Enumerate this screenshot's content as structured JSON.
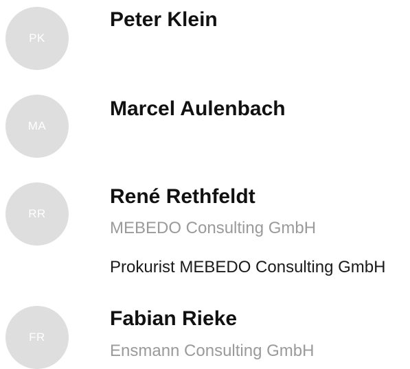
{
  "contacts": [
    {
      "initials": "PK",
      "name": "Peter Klein"
    },
    {
      "initials": "MA",
      "name": "Marcel Aulenbach"
    },
    {
      "initials": "RR",
      "name": "René Rethfeldt",
      "company": "MEBEDO Consulting GmbH",
      "role": "Prokurist MEBEDO Consulting GmbH"
    },
    {
      "initials": "FR",
      "name": "Fabian Rieke",
      "company": "Ensmann Consulting GmbH"
    }
  ],
  "colors": {
    "avatar_bg": "#dedede",
    "avatar_text": "#ffffff",
    "name": "#111111",
    "company": "#9a9a9a",
    "role": "#1a1a1a"
  }
}
